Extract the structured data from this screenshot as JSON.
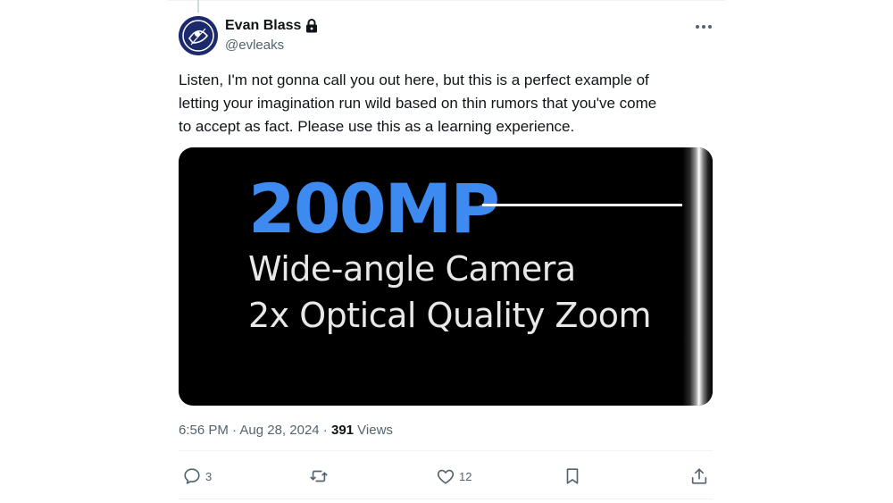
{
  "author": {
    "name": "Evan Blass",
    "handle": "@evleaks",
    "avatar_colors": [
      "#1c2a6b",
      "#ffffff"
    ]
  },
  "tweet": {
    "text": "Listen, I'm not gonna call you out here, but this is a perfect example of\nletting your imagination run wild based on thin rumors that you've come\nto accept as fact.  Please use this as a learning experience."
  },
  "media": {
    "headline": "200MP",
    "line1": "Wide-angle Camera",
    "line2": "2x Optical Quality Zoom",
    "headline_color": "#3d8af0"
  },
  "meta": {
    "time": "6:56 PM",
    "separator1": " · ",
    "date": "Aug 28, 2024",
    "separator2": " · ",
    "views_count": "391",
    "views_label": " Views"
  },
  "actions": {
    "reply_count": "3",
    "retweet_count": "",
    "like_count": "12",
    "icons": [
      "reply-icon",
      "retweet-icon",
      "heart-icon",
      "bookmark-icon",
      "share-icon"
    ]
  },
  "colors": {
    "text_primary": "#0f1419",
    "text_secondary": "#536471",
    "border": "#eff3f4"
  }
}
